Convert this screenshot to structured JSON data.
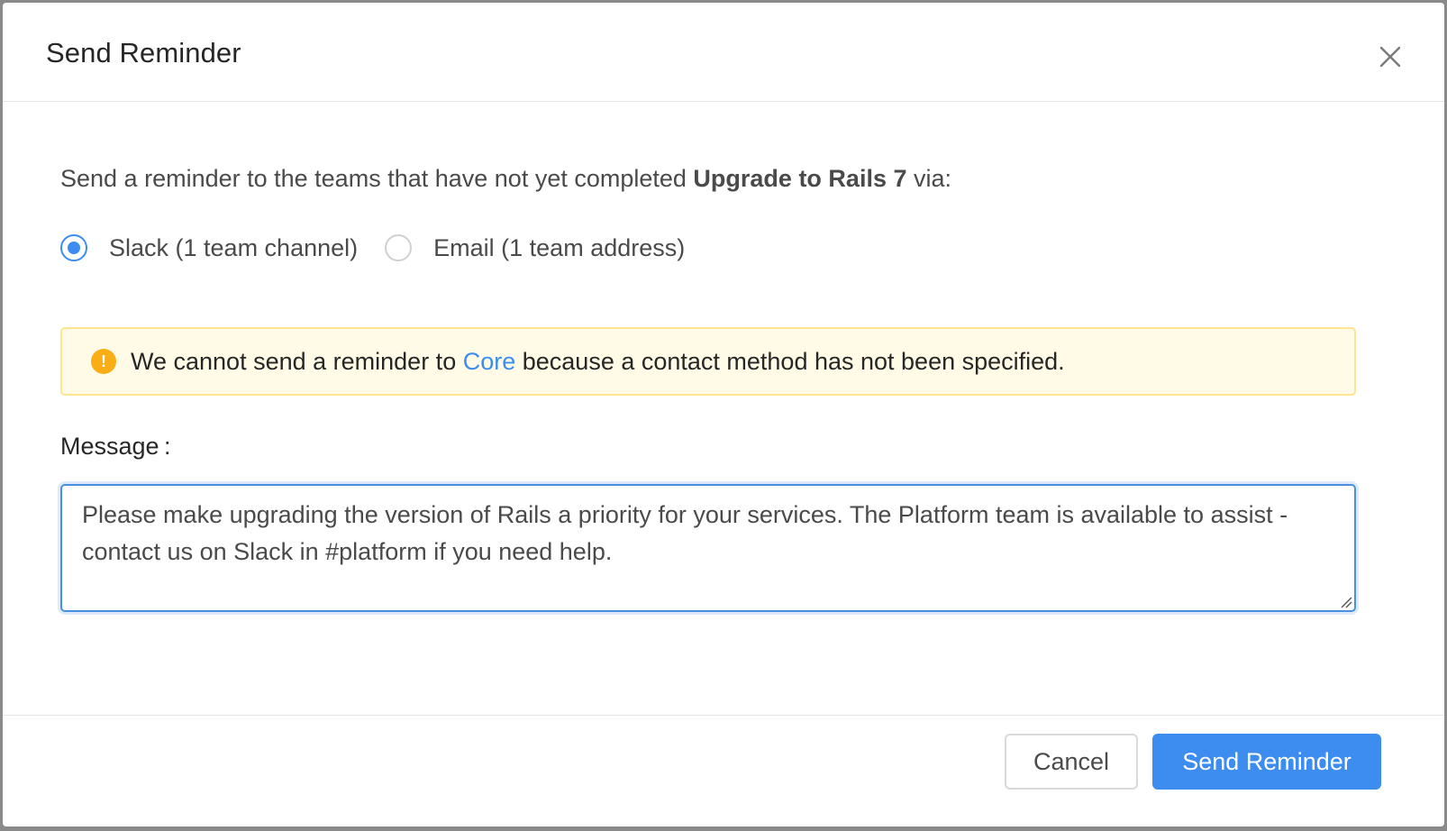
{
  "dialog": {
    "title": "Send Reminder",
    "close_icon": "close-icon"
  },
  "body": {
    "intro_prefix": "Send a reminder to the teams that have not yet completed ",
    "initiative_name": "Upgrade to Rails 7",
    "intro_suffix": " via:",
    "channels": [
      {
        "label": "Slack (1 team channel)",
        "selected": true
      },
      {
        "label": "Email (1 team address)",
        "selected": false
      }
    ],
    "warning": {
      "icon": "exclamation-circle-icon",
      "icon_glyph": "!",
      "prefix": "We cannot send a reminder to ",
      "team_link": "Core",
      "suffix": " because a contact method has not been specified.",
      "background_color": "#fffbe6",
      "border_color": "#ffe58f"
    },
    "message_label": "Message :",
    "message_value": "Please make upgrading the version of Rails a priority for your services. The Platform team is available to assist - contact us on Slack in #platform if you need help."
  },
  "footer": {
    "cancel_label": "Cancel",
    "submit_label": "Send Reminder"
  },
  "colors": {
    "accent": "#3d8cf0",
    "warning_icon": "#faad14"
  }
}
